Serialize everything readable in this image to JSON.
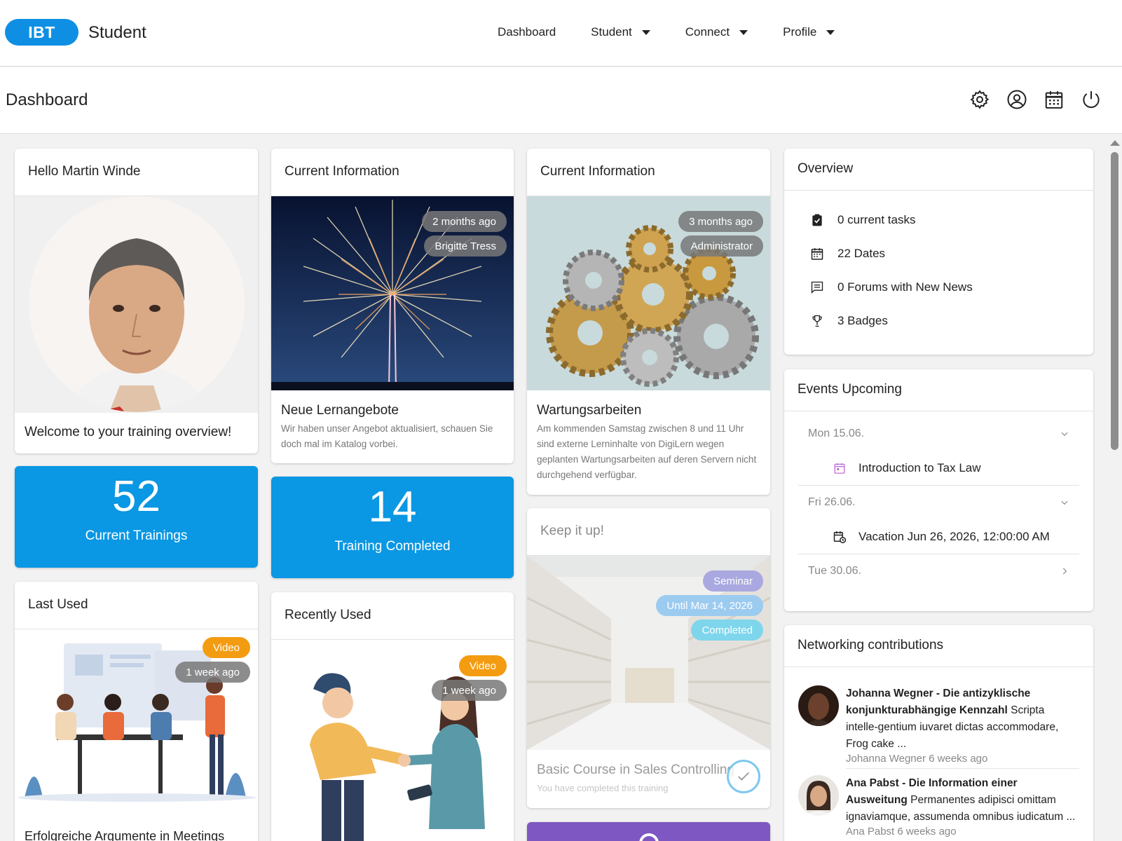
{
  "header": {
    "logo": "IBT",
    "app_name": "Student",
    "nav": [
      "Dashboard",
      "Student",
      "Connect",
      "Profile"
    ]
  },
  "page": {
    "title": "Dashboard",
    "icons": [
      "gear-icon",
      "user-circle-icon",
      "calendar-icon",
      "power-icon"
    ]
  },
  "colors": {
    "brand": "#0f8fe3",
    "stat_tile": "#0a97e3",
    "video_badge": "#f39c12",
    "completed_badge": "#7dd6ec",
    "purple_tile": "#7e57c2"
  },
  "hello": {
    "title": "Hello Martin Winde",
    "welcome": "Welcome to your training overview!"
  },
  "stats": {
    "current": {
      "value": "52",
      "label": "Current Trainings"
    },
    "completed": {
      "value": "14",
      "label": "Training Completed"
    }
  },
  "info1": {
    "header": "Current Information",
    "time": "2 months ago",
    "author": "Brigitte Tress",
    "title": "Neue Lernangebote",
    "text": "Wir haben unser Angebot aktualisiert, schauen Sie doch mal im Katalog vorbei."
  },
  "info2": {
    "header": "Current Information",
    "time": "3 months ago",
    "author": "Administrator",
    "title": "Wartungsarbeiten",
    "text": "Am kommenden Samstag zwischen 8 und 11 Uhr sind externe Lerninhalte von DigiLern wegen geplanten Wartungsarbeiten auf deren Servern nicht durchgehend verfügbar."
  },
  "last_used": {
    "header": "Last Used",
    "type": "Video",
    "time": "1 week ago",
    "caption": "Erfolgreiche Argumente in Meetings"
  },
  "recently_used": {
    "header": "Recently Used",
    "type": "Video",
    "time": "1 week ago"
  },
  "keep": {
    "header": "Keep it up!",
    "type": "Seminar",
    "until": "Until Mar 14, 2026",
    "status": "Completed",
    "title": "Basic Course in Sales Controlling",
    "subtitle": "You have completed this training"
  },
  "overview": {
    "header": "Overview",
    "items": [
      {
        "icon": "clipboard-check-icon",
        "label": "0 current tasks"
      },
      {
        "icon": "calendar-icon",
        "label": "22 Dates"
      },
      {
        "icon": "forum-icon",
        "label": "0 Forums with New News"
      },
      {
        "icon": "trophy-icon",
        "label": "3 Badges"
      }
    ]
  },
  "events": {
    "header": "Events Upcoming",
    "days": [
      {
        "date": "Mon 15.06.",
        "item": "Introduction to Tax Law",
        "icon": "calendar-event-icon"
      },
      {
        "date": "Fri 26.06.",
        "item": "Vacation Jun 26, 2026, 12:00:00 AM",
        "icon": "calendar-clock-icon"
      },
      {
        "date": "Tue 30.06."
      }
    ]
  },
  "networking": {
    "header": "Networking contributions",
    "items": [
      {
        "title": "Johanna Wegner - Die antizyklische konjunkturabhängige Kennzahl",
        "text": " Scripta intelle-gentium iuvaret dictas accommodare, Frog cake ...",
        "meta": "Johanna Wegner 6 weeks ago"
      },
      {
        "title": "Ana Pabst - Die Information einer Ausweitung",
        "text": " Permanentes adipisci omittam ignaviamque, assumenda omnibus iudicatum ...",
        "meta": "Ana Pabst 6 weeks ago"
      }
    ]
  }
}
